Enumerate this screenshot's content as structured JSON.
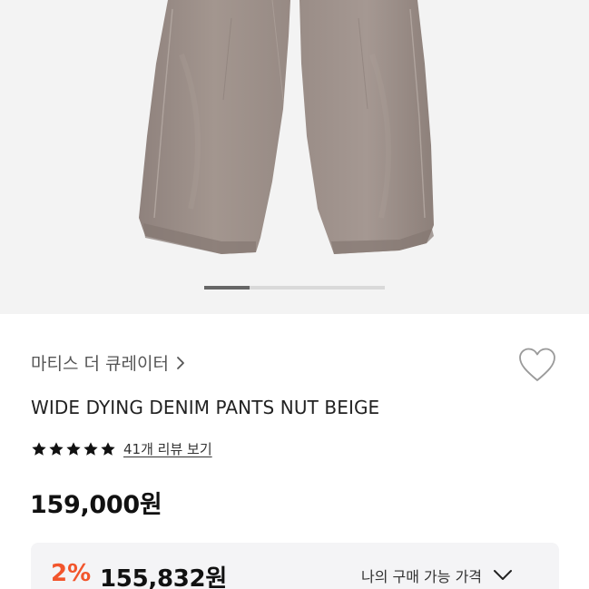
{
  "product": {
    "brand": "마티스 더 큐레이터",
    "name": "WIDE DYING DENIM PANTS NUT BEIGE",
    "rating_stars": 5,
    "review_link": "41개 리뷰 보기",
    "price": "159,000원"
  },
  "gallery": {
    "slide_index": 1,
    "slide_count": 4
  },
  "my_price": {
    "percent": "2%",
    "price": "155,832원",
    "label": "나의 구매 가능 가격"
  },
  "colors": {
    "accent": "#f2552c",
    "pants": "#9e918c",
    "background": "#f3f3f3"
  },
  "icons": {
    "brand_chevron": "chevron-right-icon",
    "wishlist": "heart-icon",
    "star": "star-icon",
    "expand": "chevron-down-icon"
  }
}
